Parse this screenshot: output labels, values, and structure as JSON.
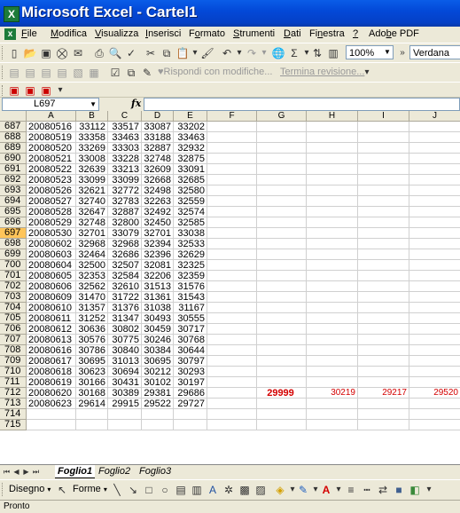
{
  "window": {
    "title": "Microsoft Excel - Cartel1"
  },
  "menu": [
    {
      "label": "File",
      "u": "F",
      "rest": "ile"
    },
    {
      "label": "Modifica",
      "u": "M",
      "rest": "odifica"
    },
    {
      "label": "Visualizza",
      "u": "V",
      "rest": "isualizza"
    },
    {
      "label": "Inserisci",
      "u": "I",
      "rest": "nserisci"
    },
    {
      "label": "Formato",
      "pre": "F",
      "u": "o",
      "rest": "rmato"
    },
    {
      "label": "Strumenti",
      "u": "S",
      "rest": "trumenti"
    },
    {
      "label": "Dati",
      "u": "D",
      "rest": "ati"
    },
    {
      "label": "Finestra",
      "pre": "Fi",
      "u": "n",
      "rest": "estra"
    },
    {
      "label": "?",
      "u": "?",
      "rest": ""
    },
    {
      "label": "Adobe PDF",
      "pre": "Ado",
      "u": "b",
      "rest": "e PDF"
    }
  ],
  "toolbar": {
    "zoom": "100%",
    "font": "Verdana",
    "respond_label": "Rispondi con modifiche...",
    "end_review_label": "Termina revisione..."
  },
  "formula": {
    "name_box": "L697",
    "fx": "fx",
    "content": ""
  },
  "columns": [
    "A",
    "B",
    "C",
    "D",
    "E",
    "F",
    "G",
    "H",
    "I",
    "J"
  ],
  "selected_row": "697",
  "rows": [
    {
      "n": "687",
      "A": "20080516",
      "B": "33112",
      "C": "33517",
      "D": "33087",
      "E": "33202"
    },
    {
      "n": "688",
      "A": "20080519",
      "B": "33358",
      "C": "33463",
      "D": "33188",
      "E": "33463"
    },
    {
      "n": "689",
      "A": "20080520",
      "B": "33269",
      "C": "33303",
      "D": "32887",
      "E": "32932"
    },
    {
      "n": "690",
      "A": "20080521",
      "B": "33008",
      "C": "33228",
      "D": "32748",
      "E": "32875"
    },
    {
      "n": "691",
      "A": "20080522",
      "B": "32639",
      "C": "33213",
      "D": "32609",
      "E": "33091"
    },
    {
      "n": "692",
      "A": "20080523",
      "B": "33099",
      "C": "33099",
      "D": "32668",
      "E": "32685"
    },
    {
      "n": "693",
      "A": "20080526",
      "B": "32621",
      "C": "32772",
      "D": "32498",
      "E": "32580"
    },
    {
      "n": "694",
      "A": "20080527",
      "B": "32740",
      "C": "32783",
      "D": "32263",
      "E": "32559"
    },
    {
      "n": "695",
      "A": "20080528",
      "B": "32647",
      "C": "32887",
      "D": "32492",
      "E": "32574"
    },
    {
      "n": "696",
      "A": "20080529",
      "B": "32748",
      "C": "32800",
      "D": "32450",
      "E": "32585"
    },
    {
      "n": "697",
      "A": "20080530",
      "B": "32701",
      "C": "33079",
      "D": "32701",
      "E": "33038"
    },
    {
      "n": "698",
      "A": "20080602",
      "B": "32968",
      "C": "32968",
      "D": "32394",
      "E": "32533"
    },
    {
      "n": "699",
      "A": "20080603",
      "B": "32464",
      "C": "32686",
      "D": "32396",
      "E": "32629"
    },
    {
      "n": "700",
      "A": "20080604",
      "B": "32500",
      "C": "32507",
      "D": "32081",
      "E": "32325"
    },
    {
      "n": "701",
      "A": "20080605",
      "B": "32353",
      "C": "32584",
      "D": "32206",
      "E": "32359"
    },
    {
      "n": "702",
      "A": "20080606",
      "B": "32562",
      "C": "32610",
      "D": "31513",
      "E": "31576"
    },
    {
      "n": "703",
      "A": "20080609",
      "B": "31470",
      "C": "31722",
      "D": "31361",
      "E": "31543"
    },
    {
      "n": "704",
      "A": "20080610",
      "B": "31357",
      "C": "31376",
      "D": "31038",
      "E": "31167"
    },
    {
      "n": "705",
      "A": "20080611",
      "B": "31252",
      "C": "31347",
      "D": "30493",
      "E": "30555"
    },
    {
      "n": "706",
      "A": "20080612",
      "B": "30636",
      "C": "30802",
      "D": "30459",
      "E": "30717"
    },
    {
      "n": "707",
      "A": "20080613",
      "B": "30576",
      "C": "30775",
      "D": "30246",
      "E": "30768"
    },
    {
      "n": "708",
      "A": "20080616",
      "B": "30786",
      "C": "30840",
      "D": "30384",
      "E": "30644"
    },
    {
      "n": "709",
      "A": "20080617",
      "B": "30695",
      "C": "31013",
      "D": "30695",
      "E": "30797"
    },
    {
      "n": "710",
      "A": "20080618",
      "B": "30623",
      "C": "30694",
      "D": "30212",
      "E": "30293"
    },
    {
      "n": "711",
      "A": "20080619",
      "B": "30166",
      "C": "30431",
      "D": "30102",
      "E": "30197"
    },
    {
      "n": "712",
      "A": "20080620",
      "B": "30168",
      "C": "30389",
      "D": "29381",
      "E": "29686",
      "G": "29999",
      "H": "30219",
      "I": "29217",
      "J": "29520"
    },
    {
      "n": "713",
      "A": "20080623",
      "B": "29614",
      "C": "29915",
      "D": "29522",
      "E": "29727"
    },
    {
      "n": "714",
      "A": "",
      "B": "",
      "C": "",
      "D": "",
      "E": ""
    },
    {
      "n": "715",
      "A": "",
      "B": "",
      "C": "",
      "D": "",
      "E": ""
    }
  ],
  "sheets": [
    "Foglio1",
    "Foglio2",
    "Foglio3"
  ],
  "active_sheet": "Foglio1",
  "drawing": {
    "draw_label": "Disegno",
    "shapes_label": "Forme"
  },
  "status": "Pronto"
}
